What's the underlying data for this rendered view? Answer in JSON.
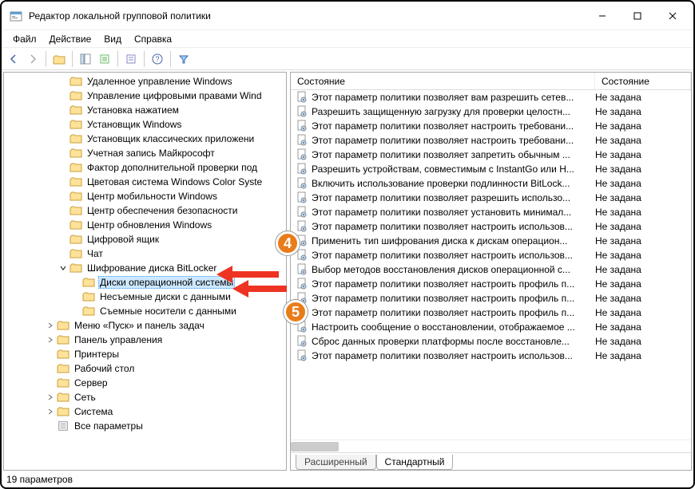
{
  "window": {
    "title": "Редактор локальной групповой политики"
  },
  "menu": {
    "file": "Файл",
    "action": "Действие",
    "view": "Вид",
    "help": "Справка"
  },
  "tree": {
    "items": [
      {
        "indent": 4,
        "toggle": "",
        "label": "Удаленное управление Windows"
      },
      {
        "indent": 4,
        "toggle": "",
        "label": "Управление цифровыми правами Wind"
      },
      {
        "indent": 4,
        "toggle": "",
        "label": "Установка нажатием"
      },
      {
        "indent": 4,
        "toggle": "",
        "label": "Установщик Windows"
      },
      {
        "indent": 4,
        "toggle": "",
        "label": "Установщик классических приложени"
      },
      {
        "indent": 4,
        "toggle": "",
        "label": "Учетная запись Майкрософт"
      },
      {
        "indent": 4,
        "toggle": "",
        "label": "Фактор дополнительной проверки под"
      },
      {
        "indent": 4,
        "toggle": "",
        "label": "Цветовая система Windows Color Syste"
      },
      {
        "indent": 4,
        "toggle": "",
        "label": "Центр мобильности Windows"
      },
      {
        "indent": 4,
        "toggle": "",
        "label": "Центр обеспечения безопасности"
      },
      {
        "indent": 4,
        "toggle": "",
        "label": "Центр обновления Windows"
      },
      {
        "indent": 4,
        "toggle": "",
        "label": "Цифровой ящик"
      },
      {
        "indent": 4,
        "toggle": "",
        "label": "Чат"
      },
      {
        "indent": 4,
        "toggle": "v",
        "label": "Шифрование диска BitLocker"
      },
      {
        "indent": 5,
        "toggle": "",
        "label": "Диски операционной системы",
        "selected": true
      },
      {
        "indent": 5,
        "toggle": "",
        "label": "Несъемные диски с данными"
      },
      {
        "indent": 5,
        "toggle": "",
        "label": "Съемные носители с данными"
      },
      {
        "indent": 3,
        "toggle": ">",
        "label": "Меню «Пуск» и панель задач"
      },
      {
        "indent": 3,
        "toggle": ">",
        "label": "Панель управления"
      },
      {
        "indent": 3,
        "toggle": "",
        "label": "Принтеры"
      },
      {
        "indent": 3,
        "toggle": "",
        "label": "Рабочий стол"
      },
      {
        "indent": 3,
        "toggle": "",
        "label": "Сервер"
      },
      {
        "indent": 3,
        "toggle": ">",
        "label": "Сеть"
      },
      {
        "indent": 3,
        "toggle": ">",
        "label": "Система"
      },
      {
        "indent": 3,
        "toggle": "",
        "label": "Все параметры",
        "icon": "settings"
      }
    ]
  },
  "list": {
    "header": {
      "col1": "Состояние",
      "col2": "Состояние"
    },
    "state_value": "Не задана",
    "items": [
      "Этот параметр политики позволяет вам разрешить сетев...",
      "Разрешить защищенную загрузку для проверки целостн...",
      "Этот параметр политики позволяет настроить требовани...",
      "Этот параметр политики позволяет настроить требовани...",
      "Этот параметр политики позволяет запретить обычным ...",
      "Разрешить устройствам, совместимым с InstantGo или H...",
      "Включить использование проверки подлинности BitLock...",
      "Этот параметр политики позволяет разрешить использо...",
      "Этот параметр политики позволяет установить минимал...",
      "Этот параметр политики позволяет настроить использов...",
      "Применить тип шифрования диска к дискам операцион...",
      "Этот параметр политики позволяет настроить использов...",
      "Выбор методов восстановления дисков операционной с...",
      "Этот параметр политики позволяет настроить профиль п...",
      "Этот параметр политики позволяет настроить профиль п...",
      "Этот параметр политики позволяет настроить профиль п...",
      "Настроить сообщение о восстановлении, отображаемое ...",
      "Сброс данных проверки платформы после восстановле...",
      "Этот параметр политики позволяет настроить использов..."
    ]
  },
  "tabs": {
    "extended": "Расширенный",
    "standard": "Стандартный"
  },
  "status": "19 параметров",
  "annotations": {
    "badge4": "4",
    "badge5": "5"
  }
}
